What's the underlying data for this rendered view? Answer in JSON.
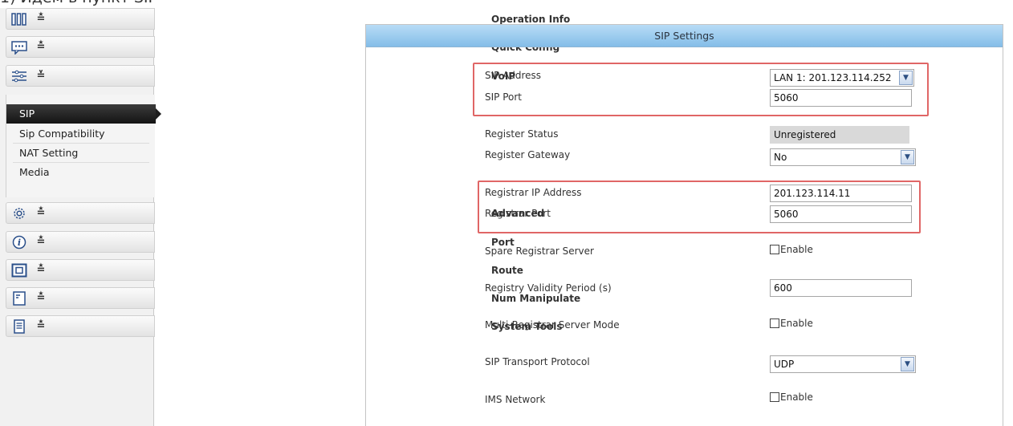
{
  "caption": "1) Идем в пункт SIP",
  "sidebar": {
    "menus": [
      {
        "label": "Operation Info",
        "icon": "bar-chart-icon",
        "chevron": "down"
      },
      {
        "label": "Quick Config",
        "icon": "chat-bubble-icon",
        "chevron": "down"
      },
      {
        "label": "VoIP",
        "icon": "voip-icon",
        "chevron": "up"
      },
      {
        "label": "Advanced",
        "icon": "gear-icon",
        "chevron": "down"
      },
      {
        "label": "Port",
        "icon": "info-icon",
        "chevron": "down"
      },
      {
        "label": "Route",
        "icon": "route-icon",
        "chevron": "down"
      },
      {
        "label": "Num Manipulate",
        "icon": "document-icon",
        "chevron": "down"
      },
      {
        "label": "System Tools",
        "icon": "tools-icon",
        "chevron": "down"
      }
    ],
    "voip_submenu": {
      "active": "SIP",
      "items": [
        "Sip Compatibility",
        "NAT Setting",
        "Media"
      ]
    }
  },
  "panel": {
    "title": "SIP Settings",
    "fields": {
      "sip_address": {
        "label": "SIP Address",
        "value": "LAN 1: 201.123.114.252"
      },
      "sip_port": {
        "label": "SIP Port",
        "value": "5060"
      },
      "register_status": {
        "label": "Register Status",
        "value": "Unregistered"
      },
      "register_gateway": {
        "label": "Register Gateway",
        "value": "No"
      },
      "registrar_ip": {
        "label": "Registrar IP Address",
        "value": "201.123.114.11"
      },
      "registrar_port": {
        "label": "Registrar Port",
        "value": "5060"
      },
      "spare_registrar": {
        "label": "Spare Registrar Server",
        "option": "Enable",
        "checked": false
      },
      "registry_validity": {
        "label": "Registry Validity Period (s)",
        "value": "600"
      },
      "multi_registrar": {
        "label": "Multi-Registrar Server Mode",
        "option": "Enable",
        "checked": false
      },
      "transport": {
        "label": "SIP Transport Protocol",
        "value": "UDP"
      },
      "ims_network": {
        "label": "IMS Network",
        "option": "Enable",
        "checked": false
      }
    }
  },
  "colors": {
    "highlight": "#e06666",
    "header": "#9fcdef",
    "active_item": "#1e1e1e"
  }
}
